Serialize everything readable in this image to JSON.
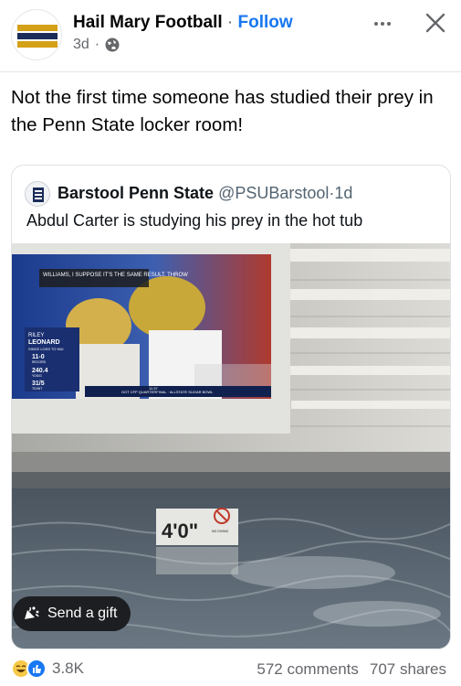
{
  "post": {
    "page_name": "Hail Mary Football",
    "separator": "·",
    "follow_label": "Follow",
    "time": "3d",
    "time_separator": "·",
    "privacy_icon": "globe-icon",
    "caption": "Not the first time someone has studied their prey in the Penn State locker room!"
  },
  "quoted": {
    "name": "Barstool Penn State",
    "handle": "@PSUBarstool",
    "separator": "·",
    "time": "1d",
    "text": "Abdul Carter is studying his prey in the hot tub"
  },
  "photo": {
    "tv_banner": "WILLIAMS, I SUPPOSE IT'S THE SAME RESULT. THROW",
    "player_first": "RILEY",
    "player_last": "LEONARD",
    "stat_header": "SINCE LOSS TO NIU",
    "stat1_value": "11-0",
    "stat1_label": "RECORD",
    "stat2_value": "240.4",
    "stat2_label": "YDS/G",
    "stat3_value": "31/5",
    "stat3_label": "TD/INT",
    "ticker_text": "GOT CFP QUARTERFINAL · ALLSTATE SUGAR BOWL",
    "ticker_clock": "11:37",
    "depth_marker": "4'0\"",
    "no_diving": "NO DIVING"
  },
  "gift_button": {
    "label": "Send a gift",
    "icon": "gift-icon"
  },
  "footer": {
    "reaction_icons": [
      "haha-icon",
      "like-icon"
    ],
    "reaction_count": "3.8K",
    "comments": "572 comments",
    "shares": "707 shares"
  },
  "colors": {
    "accent": "#1877f2",
    "muted": "#65676b",
    "text": "#050505",
    "tv_blue": "#1a3a8c"
  }
}
